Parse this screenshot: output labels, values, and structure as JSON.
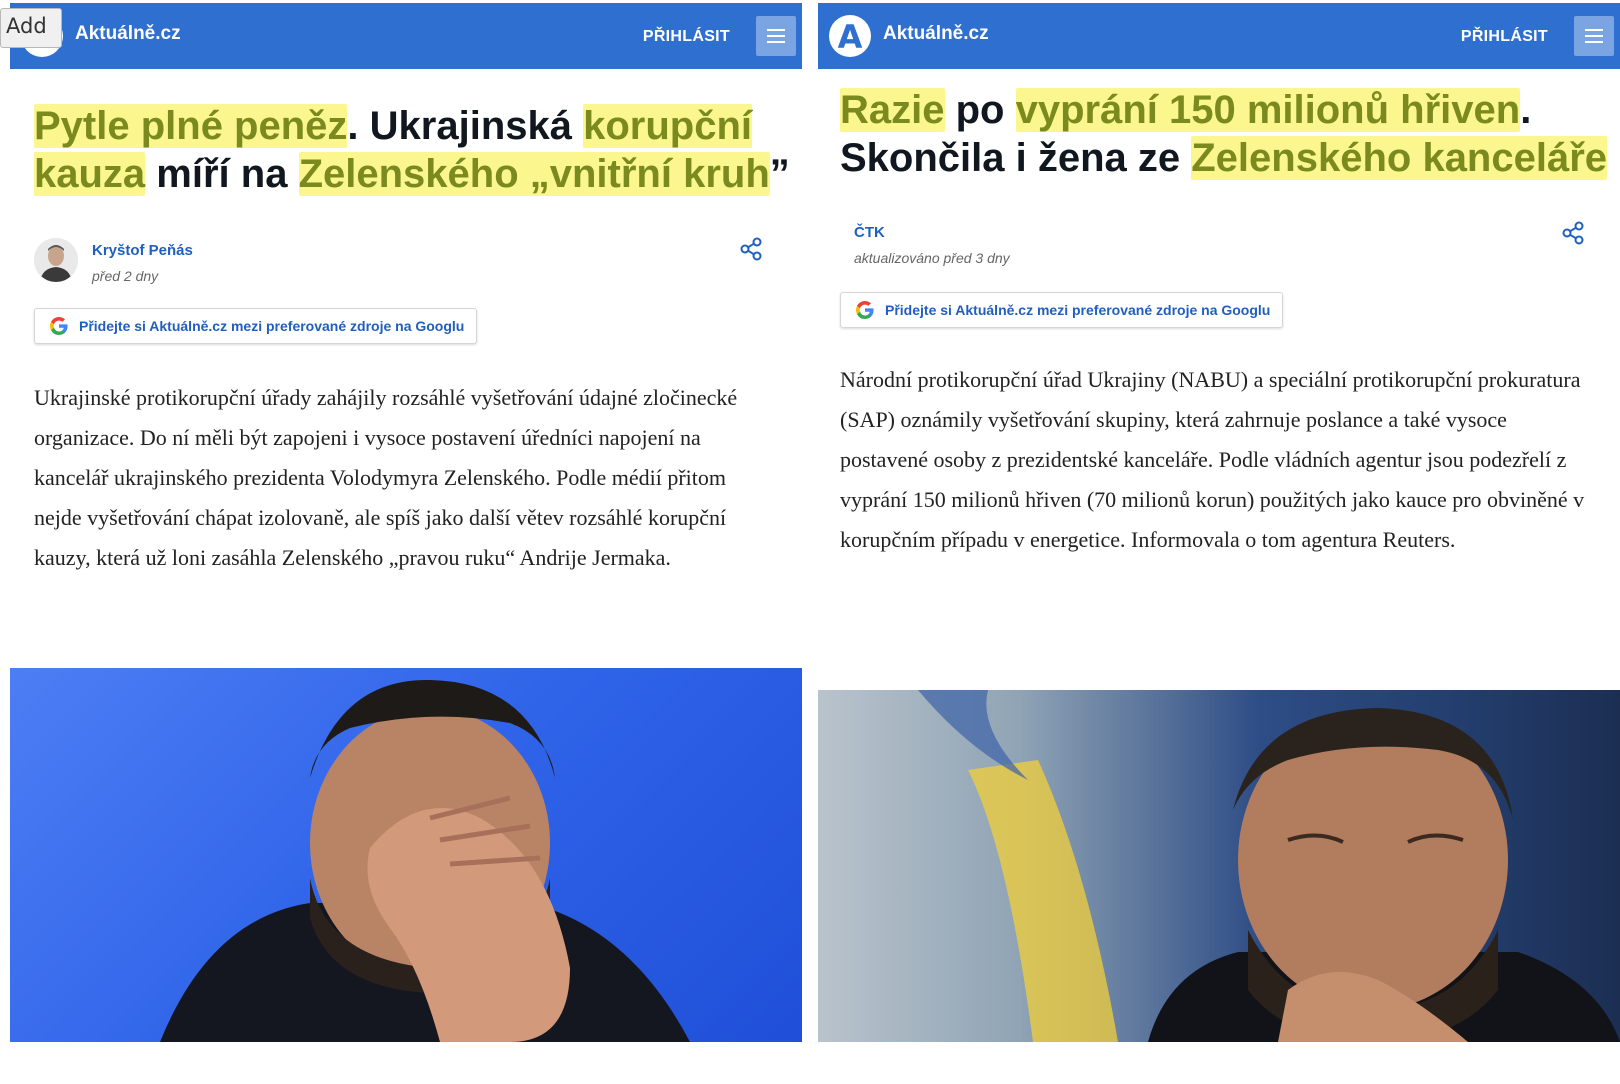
{
  "overlay": {
    "add_label": "Add"
  },
  "left": {
    "header": {
      "logo_letter": "A",
      "brand": "Aktuálně.cz",
      "login": "PŘIHLÁSIT"
    },
    "headline": [
      {
        "text": "Pytle plné peněz",
        "highlight": true
      },
      {
        "text": ". Ukrajinská ",
        "highlight": false
      },
      {
        "text": "korupční kauza",
        "highlight": true
      },
      {
        "text": " míří na ",
        "highlight": false
      },
      {
        "text": "Zelenského „vnitřní kruh",
        "highlight": true
      },
      {
        "text": "”",
        "highlight": false
      }
    ],
    "author": {
      "name": "Kryštof Peňás",
      "date": "před 2 dny"
    },
    "google_cta": "Přidejte si Aktuálně.cz mezi preferované zdroje na Googlu",
    "body": "Ukrajinské protikorupční úřady zahájily rozsáhlé vyšetřování údajné zločinecké organizace. Do ní měli být zapojeni i vysoce postavení úředníci napojení na kancelář ukrajinského prezidenta Volodymyra Zelenského. Podle médií přitom nejde vyšetřování chápat izolovaně, ale spíš jako další větev rozsáhlé korupční kauzy, která už loni zasáhla Zelenského „pravou ruku“ Andrije Jermaka."
  },
  "right": {
    "header": {
      "logo_letter": "A",
      "brand": "Aktuálně.cz",
      "login": "PŘIHLÁSIT"
    },
    "headline": [
      {
        "text": "Razie",
        "highlight": true
      },
      {
        "text": " po ",
        "highlight": false
      },
      {
        "text": "vyprání 150 milionů hřiven",
        "highlight": true
      },
      {
        "text": ". Skončila i žena ze ",
        "highlight": false
      },
      {
        "text": "Zelenského kanceláře",
        "highlight": true
      }
    ],
    "author": {
      "name": "ČTK",
      "date": "aktualizováno před 3 dny"
    },
    "google_cta": "Přidejte si Aktuálně.cz mezi preferované zdroje na Googlu",
    "body": "Národní protikorupční úřad Ukrajiny (NABU) a speciální protikorupční prokuratura (SAP) oznámily vyšetřování skupiny, která zahrnuje poslance a také vysoce postavené osoby z prezidentské kanceláře. Podle vládních agentur jsou podezřelí z vyprání 150 milionů hřiven (70 milionů korun) použitých jako kauce pro obviněné v korupčním případu v energetice. Informovala o tom agentura Reuters."
  },
  "colors": {
    "header_blue": "#2f6fcf",
    "highlight_bg": "#fbf78e",
    "highlight_text": "#7b8a1e",
    "link_blue": "#1f5fbf"
  }
}
